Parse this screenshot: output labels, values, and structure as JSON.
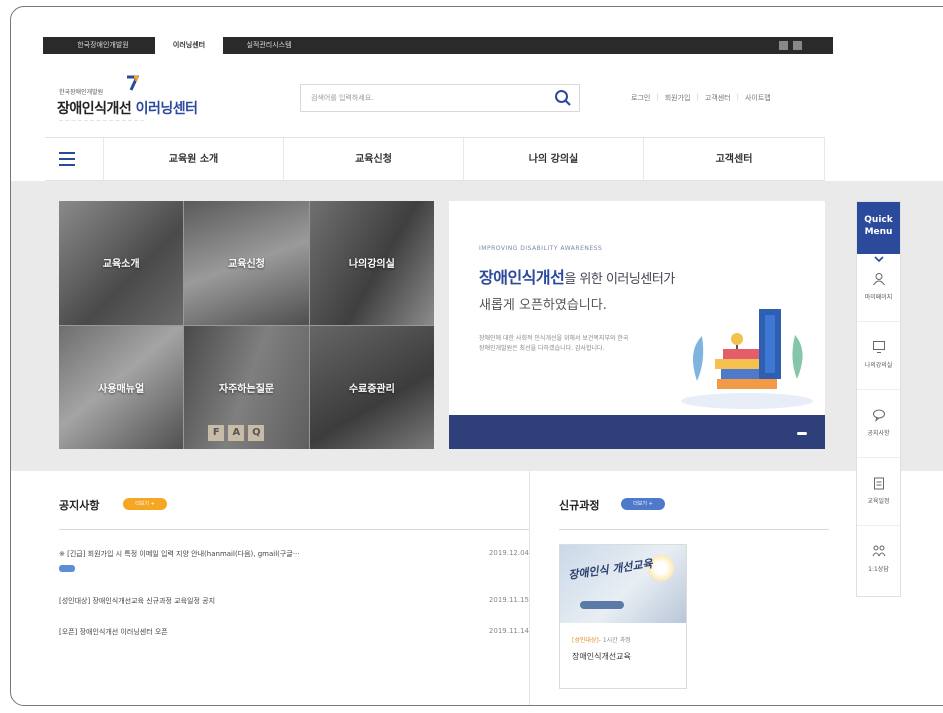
{
  "utility_bar": {
    "sites": [
      "한국장애인개발원",
      "이러닝센터",
      "실적관리시스템"
    ],
    "active_index": 1
  },
  "header": {
    "org_name": "한국장애인개발원",
    "title_part1": "장애인식개선 ",
    "title_part2": "이러닝센터",
    "search_placeholder": "검색어를 입력하세요.",
    "links": [
      "로그인",
      "회원가입",
      "고객센터",
      "사이트맵"
    ]
  },
  "nav": {
    "items": [
      "교육원 소개",
      "교육신청",
      "나의 강의실",
      "고객센터"
    ]
  },
  "tiles": [
    "교육소개",
    "교육신청",
    "나의강의실",
    "사용매뉴얼",
    "자주하는질문",
    "수료증관리"
  ],
  "banner": {
    "kicker": "IMPROVING DISABILITY AWARENESS",
    "headline_bold": "장애인식개선",
    "headline_rest": "을 위한 이러닝센터가",
    "headline_line2": "새롭게 오픈하였습니다.",
    "description": "장애인에 대한 사회적 인식개선을 위해서 보건복지부와 한국장애인개발원은 최선을 다하겠습니다. 감사합니다."
  },
  "quick_menu": {
    "title_line1": "Quick",
    "title_line2": "Menu",
    "items": [
      "마이페이지",
      "나의강의실",
      "공지사항",
      "교육일정",
      "1:1상담"
    ]
  },
  "notices": {
    "title": "공지사항",
    "more_label": "더보기 +",
    "items": [
      {
        "title": "※ [긴급] 회원가입 시 특정 이메일 입력 지양 안내(hanmail(다음), gmail(구글···",
        "date": "2019.12.04",
        "is_new": true
      },
      {
        "title": "[성인대상] 장애인식개선교육 신규과정 교육일정 공지",
        "date": "2019.11.15",
        "is_new": false
      },
      {
        "title": "[오픈] 장애인식개선 이러닝센터 오픈",
        "date": "2019.11.14",
        "is_new": false
      }
    ]
  },
  "new_courses": {
    "title": "신규과정",
    "more_label": "더보기 +",
    "card": {
      "thumb_text": "장애인식 개선교육",
      "category": "[성인대상]",
      "hours": "- 1시간 과정",
      "name": "장애인식개선교육"
    }
  },
  "colors": {
    "brand_blue": "#2b4a9b",
    "orange": "#f5a623",
    "banner_bar": "#2f3f7a"
  }
}
